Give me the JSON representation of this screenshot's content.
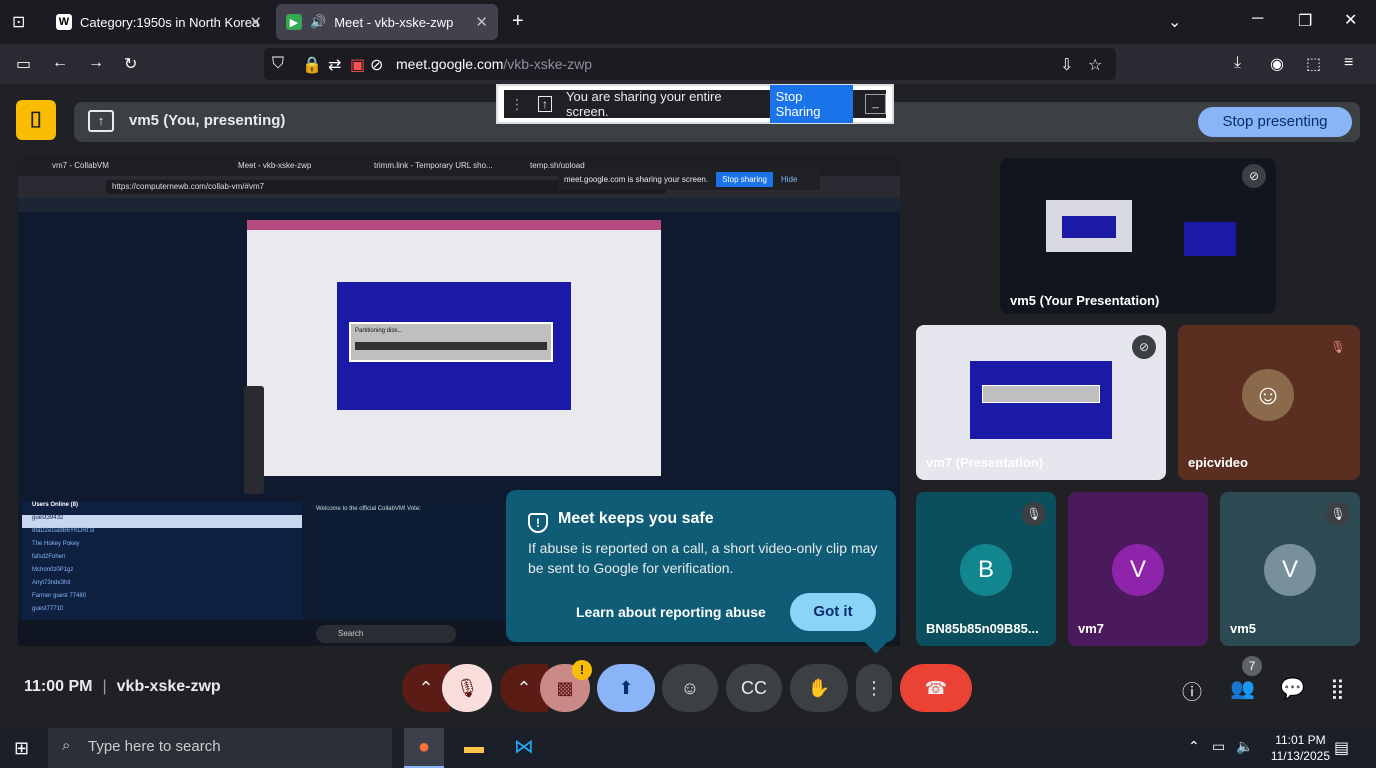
{
  "browser": {
    "tabs": [
      {
        "label": "Category:1950s in North Korea",
        "favicon": "W"
      },
      {
        "label": "Meet - vkb-xske-zwp",
        "active": true
      }
    ],
    "url_host": "meet.google.com",
    "url_path": "/vkb-xske-zwp"
  },
  "meet": {
    "presenting_label": "vm5 (You, presenting)",
    "stop_presenting": "Stop presenting",
    "sharing_bar": {
      "text": "You are sharing your entire screen.",
      "stop": "Stop Sharing"
    },
    "shared_screen": {
      "tabs": [
        "vm7 - CollabVM",
        "Meet - vkb-xske-zwp",
        "trimm.link - Temporary URL sho...",
        "temp.sh/upload"
      ],
      "url": "https://computernewb.com/collab-vm/#vm7",
      "share_notice": "meet.google.com is sharing your screen.",
      "stop_sharing": "Stop sharing",
      "hide": "Hide",
      "dialog_title": "Partitioning disk...",
      "search": "Search",
      "users_header": "Users Online (8)",
      "users": [
        "guest39432",
        "8faD2eGa9B6YKDRf.sl",
        "The Hokey Pokey",
        "fafsd2Fohen",
        "Mchon0z0P1gz",
        "Anyt73nde3hit",
        "Farmer guest 77480",
        "guest77710"
      ],
      "chat_intro": "Welcome to the official CollabVM! Vote:"
    },
    "tiles": [
      {
        "name": "vm5 (Your Presentation)",
        "type": "presentation"
      },
      {
        "name": "vm7 (Presentation)",
        "type": "presentation"
      },
      {
        "name": "epicvideo",
        "type": "video"
      },
      {
        "name": "BN85b85n09B85...",
        "initial": "B",
        "color": "#12868f"
      },
      {
        "name": "vm7",
        "initial": "V",
        "color": "#8e24aa"
      },
      {
        "name": "vm5",
        "initial": "V",
        "color": "#78909c"
      }
    ],
    "safety_popup": {
      "title": "Meet keeps you safe",
      "body": "If abuse is reported on a call, a short video-only clip may be sent to Google for verification.",
      "learn": "Learn about reporting abuse",
      "got_it": "Got it"
    },
    "footer": {
      "time": "11:00 PM",
      "code": "vkb-xske-zwp",
      "people_count": "7"
    }
  },
  "taskbar": {
    "search_placeholder": "Type here to search",
    "time": "11:01 PM",
    "date": "11/13/2025"
  },
  "colors": {
    "accent_blue": "#8ab4f8",
    "end_call_red": "#ea4335",
    "popup_teal": "#0e5c75"
  }
}
